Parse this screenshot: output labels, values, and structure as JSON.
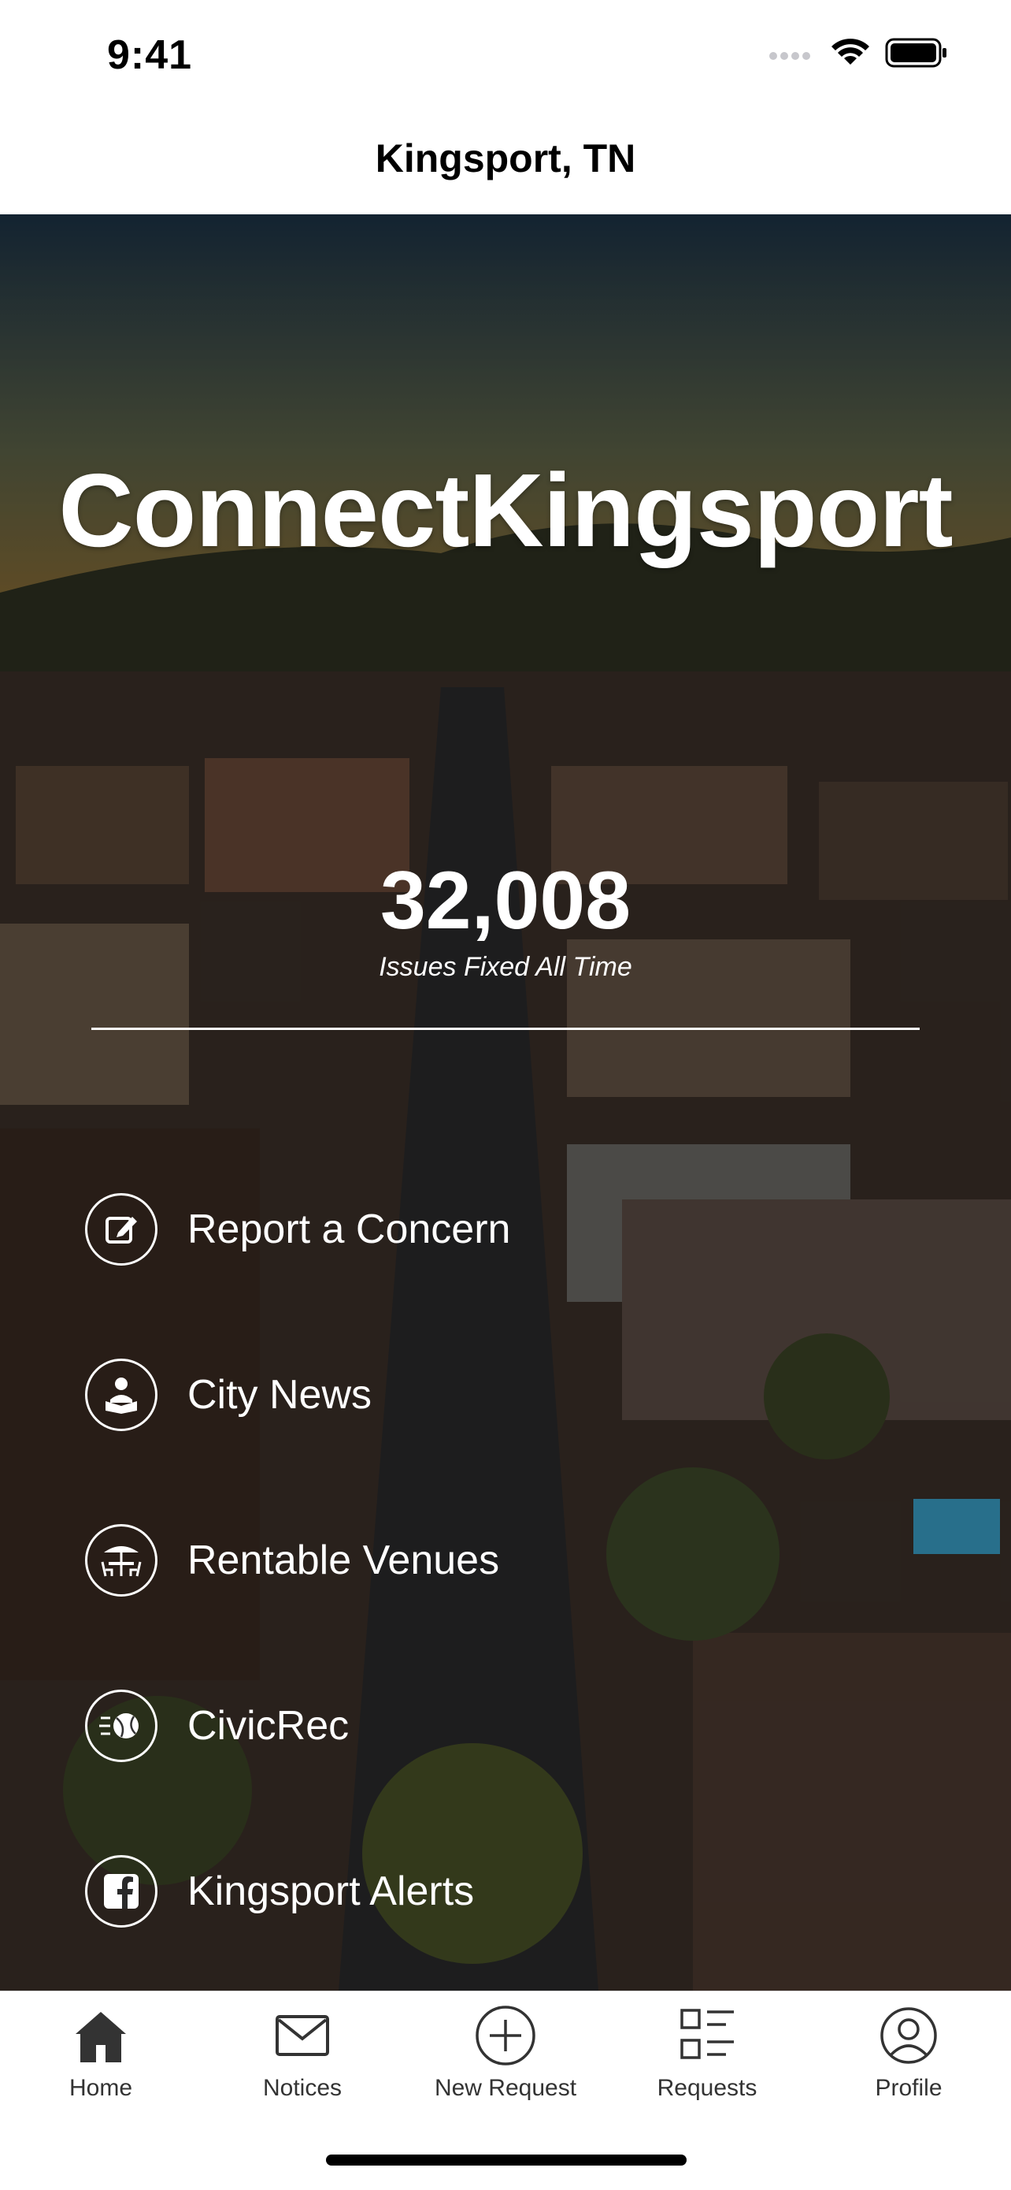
{
  "status_bar": {
    "time": "9:41"
  },
  "nav": {
    "title": "Kingsport, TN"
  },
  "hero": {
    "brand": "ConnectKingsport",
    "stat_value": "32,008",
    "stat_label": "Issues Fixed All Time"
  },
  "menu": {
    "items": [
      {
        "label": "Report a Concern",
        "icon": "edit-icon"
      },
      {
        "label": "City News",
        "icon": "news-reader-icon"
      },
      {
        "label": "Rentable Venues",
        "icon": "venue-table-icon"
      },
      {
        "label": "CivicRec",
        "icon": "sports-ball-icon"
      },
      {
        "label": "Kingsport Alerts",
        "icon": "facebook-icon"
      }
    ]
  },
  "tab_bar": {
    "tabs": [
      {
        "label": "Home",
        "icon": "home-icon"
      },
      {
        "label": "Notices",
        "icon": "mail-icon"
      },
      {
        "label": "New Request",
        "icon": "plus-circle-icon"
      },
      {
        "label": "Requests",
        "icon": "list-icon"
      },
      {
        "label": "Profile",
        "icon": "profile-icon"
      }
    ]
  },
  "colors": {
    "tab_icon": "#333333",
    "text_on_hero": "#ffffff"
  }
}
